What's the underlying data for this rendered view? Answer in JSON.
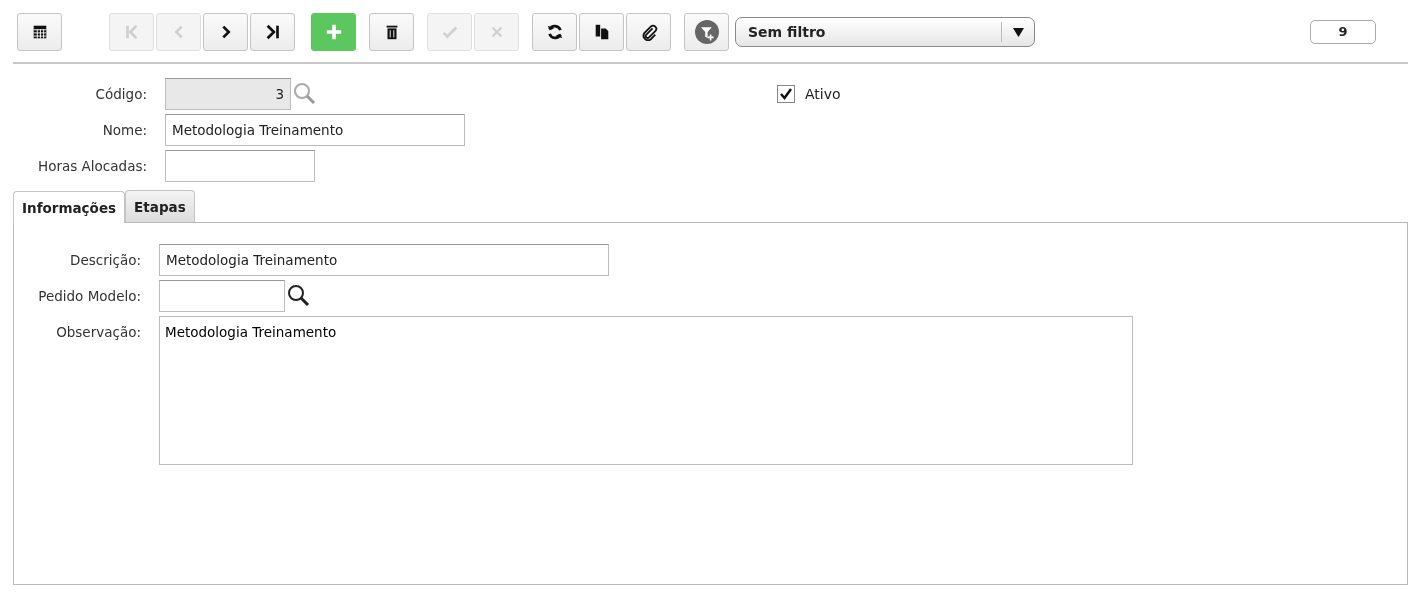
{
  "toolbar": {
    "groups": [
      {
        "buttons": [
          {
            "kind": "grid",
            "disabled": false
          }
        ]
      },
      {
        "buttons": [
          {
            "kind": "first",
            "disabled": true
          },
          {
            "kind": "prev",
            "disabled": true
          },
          {
            "kind": "next",
            "disabled": false
          },
          {
            "kind": "last",
            "disabled": false
          }
        ]
      },
      {
        "buttons": [
          {
            "kind": "add",
            "disabled": false
          }
        ]
      },
      {
        "buttons": [
          {
            "kind": "delete",
            "disabled": false
          }
        ]
      },
      {
        "buttons": [
          {
            "kind": "confirm",
            "disabled": true
          },
          {
            "kind": "cancel",
            "disabled": true
          }
        ]
      },
      {
        "buttons": [
          {
            "kind": "refresh",
            "disabled": false
          },
          {
            "kind": "copy",
            "disabled": false
          },
          {
            "kind": "attach",
            "disabled": false
          }
        ]
      },
      {
        "buttons": [
          {
            "kind": "filter",
            "disabled": false
          }
        ]
      }
    ],
    "filter_select": {
      "value": "Sem filtro"
    },
    "record_count": "9"
  },
  "form": {
    "fields": [
      {
        "label": "Código:",
        "value": "3",
        "disabled": true,
        "lookup": true
      },
      {
        "label": "Nome:",
        "value": "Metodologia Treinamento"
      },
      {
        "label": "Horas Alocadas:"
      }
    ],
    "active_checkbox": {
      "label": "Ativo",
      "checked": true
    }
  },
  "tabs": [
    {
      "label": "Informações",
      "selected": true
    },
    {
      "label": "Etapas",
      "selected": false
    }
  ],
  "tab_panel": {
    "fields": [
      {
        "kind": "input",
        "label": "Descrição:",
        "value": "Metodologia Treinamento"
      },
      {
        "kind": "input",
        "label": "Pedido Modelo:",
        "lookup": true
      },
      {
        "kind": "textarea",
        "label": "Observação:",
        "value": "Metodologia Treinamento"
      }
    ]
  }
}
